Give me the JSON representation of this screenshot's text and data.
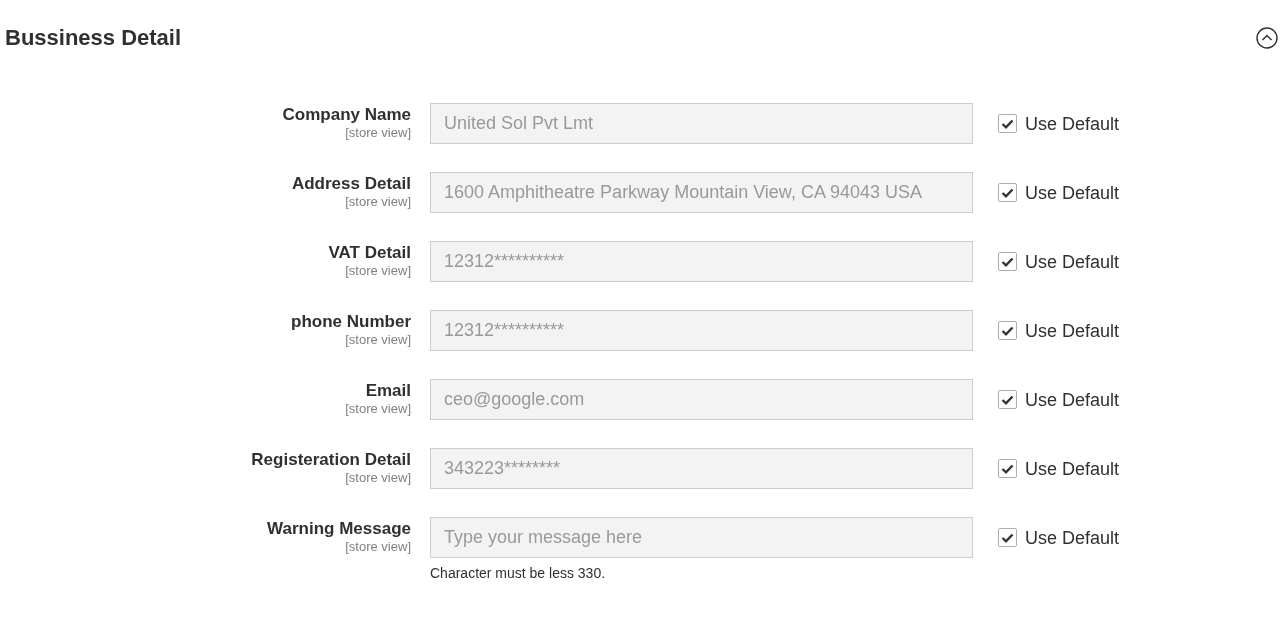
{
  "section": {
    "title": "Bussiness Detail",
    "expanded": true
  },
  "fields": [
    {
      "label": "Company Name",
      "scope": "[store view]",
      "value": "United Sol Pvt Lmt",
      "disabled": true,
      "use_default": {
        "label": "Use Default",
        "checked": true
      }
    },
    {
      "label": "Address Detail",
      "scope": "[store view]",
      "value": "1600 Amphitheatre Parkway Mountain View, CA 94043 USA",
      "disabled": true,
      "use_default": {
        "label": "Use Default",
        "checked": true
      }
    },
    {
      "label": "VAT Detail",
      "scope": "[store view]",
      "value": "12312**********",
      "disabled": true,
      "use_default": {
        "label": "Use Default",
        "checked": true
      }
    },
    {
      "label": "phone Number",
      "scope": "[store view]",
      "value": "12312**********",
      "disabled": true,
      "use_default": {
        "label": "Use Default",
        "checked": true
      }
    },
    {
      "label": "Email",
      "scope": "[store view]",
      "value": "ceo@google.com",
      "disabled": true,
      "use_default": {
        "label": "Use Default",
        "checked": true
      }
    },
    {
      "label": "Registeration Detail",
      "scope": "[store view]",
      "value": "343223********",
      "disabled": true,
      "use_default": {
        "label": "Use Default",
        "checked": true
      }
    },
    {
      "label": "Warning Message",
      "scope": "[store view]",
      "placeholder": "Type your message here",
      "disabled": true,
      "note": "Character must be less 330.",
      "use_default": {
        "label": "Use Default",
        "checked": true
      }
    }
  ]
}
